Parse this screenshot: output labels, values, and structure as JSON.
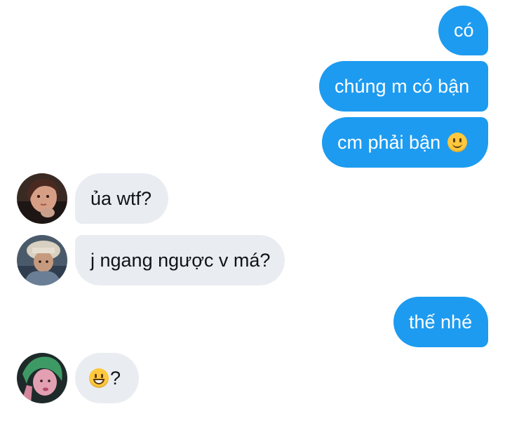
{
  "conversation": {
    "messages": [
      {
        "direction": "outgoing",
        "text": "có"
      },
      {
        "direction": "outgoing",
        "text": "chúng m có bận"
      },
      {
        "direction": "outgoing",
        "text": "cm phải bận",
        "emoji": "slightly-smiling-face-icon"
      },
      {
        "direction": "incoming",
        "text": "ủa wtf?",
        "avatar": "avatar-user-1"
      },
      {
        "direction": "incoming",
        "text": "j ngang ngược v má?",
        "avatar": "avatar-user-2"
      },
      {
        "direction": "outgoing",
        "text": "thế nhé"
      },
      {
        "direction": "incoming",
        "emoji": "grinning-face-icon",
        "text": "?",
        "avatar": "avatar-user-3"
      }
    ]
  },
  "colors": {
    "outgoing_bubble": "#1d9bf0",
    "incoming_bubble": "#e9edf1",
    "outgoing_text": "#ffffff",
    "incoming_text": "#0f1419"
  }
}
